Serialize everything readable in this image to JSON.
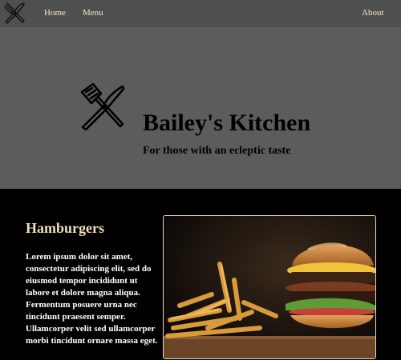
{
  "nav": {
    "home_label": "Home",
    "menu_label": "Menu",
    "about_label": "About",
    "logo_icon": "utensils-icon"
  },
  "hero": {
    "title": "Bailey's Kitchen",
    "tagline": "For those with an ecleptic taste",
    "logo_icon": "utensils-icon"
  },
  "section": {
    "heading": "Hamburgers",
    "body": "Lorem ipsum dolor sit amet, consectetur adipiscing elit, sed do eiusmod tempor incididunt ut labore et dolore magna aliqua. Fermentum posuere urna nec tincidunt praesent semper. Ullamcorper velit sed ullamcorper morbi tincidunt ornare massa eget.",
    "image_icon": "hamburger-photo"
  },
  "colors": {
    "nav_bg": "#4f4f4f",
    "hero_bg": "#5c5c5c",
    "accent": "#f3ddbb"
  }
}
